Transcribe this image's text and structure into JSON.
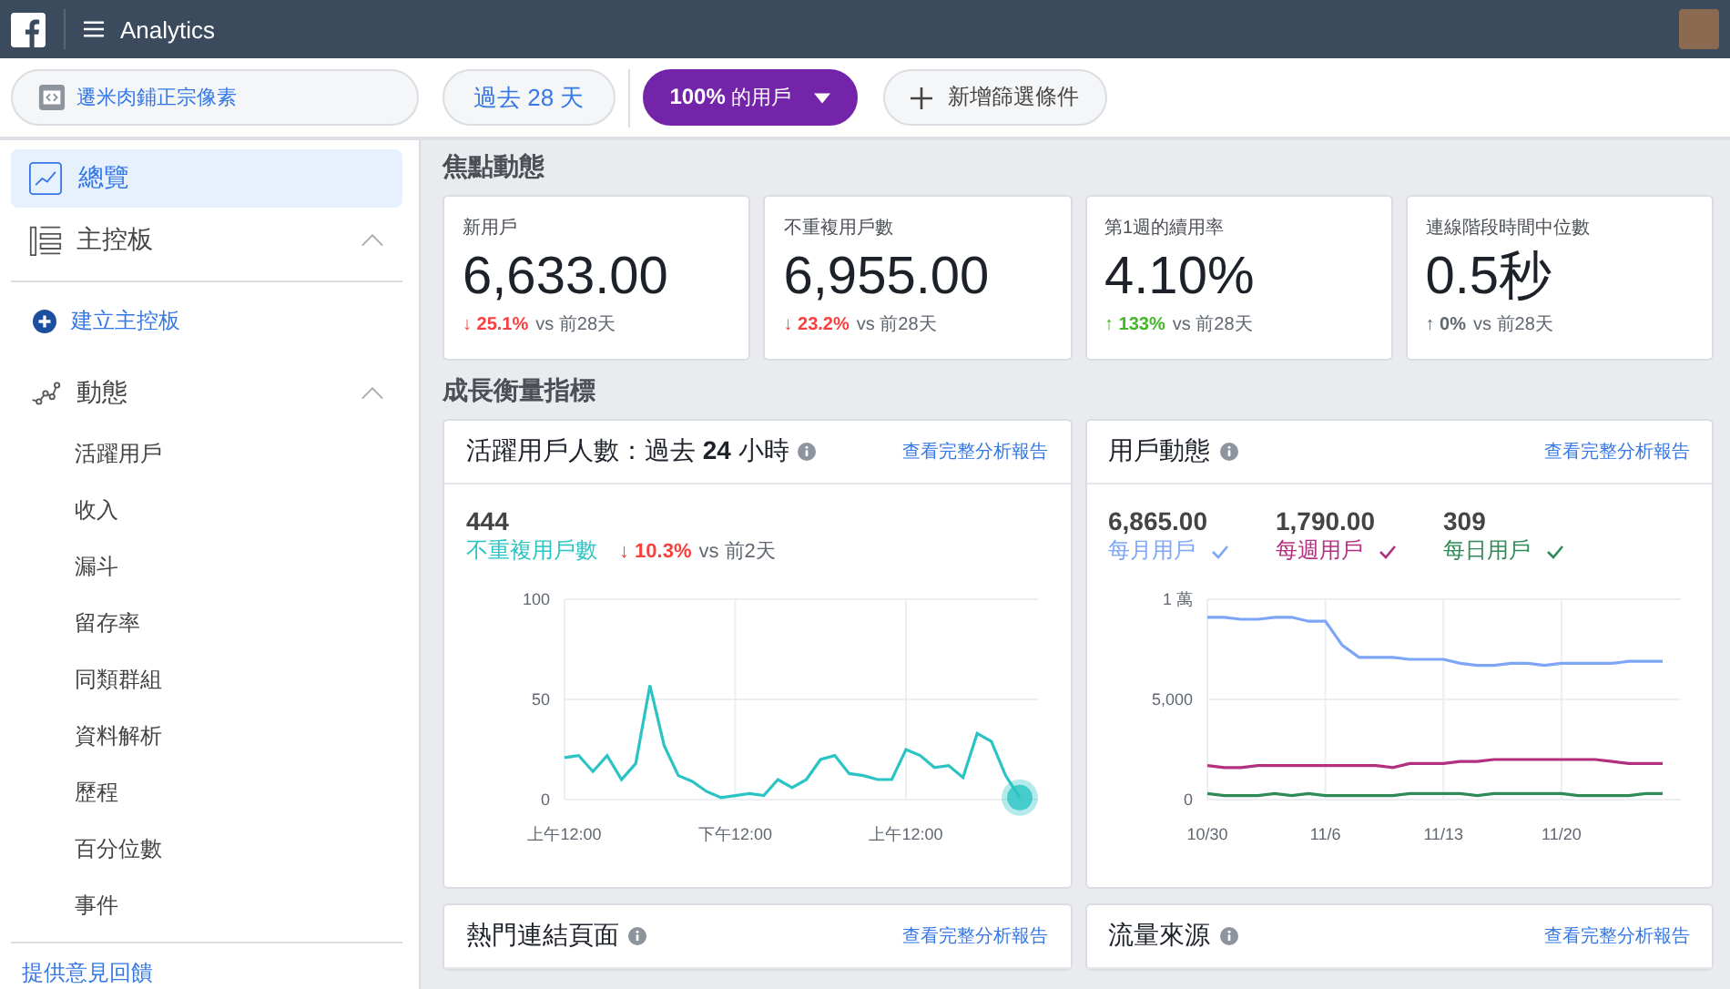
{
  "top_bar": {
    "title": "Analytics"
  },
  "filters": {
    "source": "遷米肉鋪正宗像素",
    "date_range": "過去 28 天",
    "segment": "**100%** 的用戶",
    "add_filter": "新增篩選條件"
  },
  "sidebar": {
    "items": [
      {
        "kind": "link",
        "label": "總覽",
        "selected": true
      },
      {
        "kind": "section",
        "label": "主控板",
        "expanded": true,
        "children": [
          {
            "kind": "create",
            "label": "建立主控板",
            "selected": false
          }
        ]
      },
      {
        "kind": "section",
        "label": "動態",
        "expanded": true,
        "children": [
          {
            "kind": "link",
            "label": "活躍用戶",
            "selected": false
          },
          {
            "kind": "link",
            "label": "收入",
            "selected": false
          },
          {
            "kind": "link",
            "label": "漏斗",
            "selected": false
          },
          {
            "kind": "link",
            "label": "留存率",
            "selected": false
          },
          {
            "kind": "link",
            "label": "同類群組",
            "selected": false
          },
          {
            "kind": "link",
            "label": "資料解析",
            "selected": false
          },
          {
            "kind": "link",
            "label": "歷程",
            "selected": false
          },
          {
            "kind": "link",
            "label": "百分位數",
            "selected": false
          },
          {
            "kind": "link",
            "label": "事件",
            "selected": false
          }
        ]
      }
    ],
    "feedback": "提供意見回饋"
  },
  "highlights": {
    "title": "焦點動態",
    "metrics": [
      {
        "label": "新用戶",
        "value": "6,633.00",
        "arrow": "↓",
        "change": "25.1%",
        "color": "#fa3e3e",
        "comparison": "vs 前28天"
      },
      {
        "label": "不重複用戶數",
        "value": "6,955.00",
        "arrow": "↓",
        "change": "23.2%",
        "color": "#fa3e3e",
        "comparison": "vs 前28天"
      },
      {
        "label": "第1週的續用率",
        "value": "4.10%",
        "arrow": "↑",
        "change": "133%",
        "color": "#42b72a",
        "comparison": "vs 前28天"
      },
      {
        "label": "連線階段時間中位數",
        "value": "0.5秒",
        "arrow": "↑",
        "change": "0%",
        "color": "#606770",
        "comparison": "vs 前28天"
      }
    ]
  },
  "growth": {
    "title": "成長衡量指標",
    "cards": [
      {
        "kind": "single",
        "title": "活躍用戶人數：過去 **24** 小時",
        "link": "查看完整分析報告",
        "total": "444",
        "arrow": "↓",
        "change": "10.3%",
        "color": "#fa3e3e",
        "comparison": "vs 前2天",
        "chart_data": {
          "type": "line",
          "categories": [
            "上午12:00",
            null,
            null,
            null,
            null,
            null,
            null,
            null,
            null,
            null,
            null,
            null,
            "下午12:00",
            null,
            null,
            null,
            null,
            null,
            null,
            null,
            null,
            null,
            null,
            null,
            "上午12:00",
            null,
            null,
            null,
            null,
            null,
            null,
            null,
            null
          ],
          "series": [
            {
              "name": "不重複用戶數",
              "color": "#2bc4c4",
              "values": [
                21,
                22,
                14,
                22,
                10,
                18,
                57,
                27,
                12,
                9,
                4,
                1,
                2,
                3,
                2,
                10,
                6,
                10,
                20,
                22,
                13,
                12,
                10,
                10,
                25,
                22,
                16,
                17,
                11,
                33,
                29,
                12,
                1
              ]
            }
          ],
          "ylim": [
            0,
            100
          ],
          "yticks": [
            0,
            50,
            100
          ],
          "grid": true
        }
      },
      {
        "kind": "multi",
        "title": "用戶動態",
        "link": "查看完整分析報告",
        "totals": [
          "6,865.00",
          "1,790.00",
          "309"
        ],
        "chart_data": {
          "type": "line",
          "categories": [
            "10/30",
            null,
            null,
            null,
            null,
            null,
            null,
            "11/6",
            null,
            null,
            null,
            null,
            null,
            null,
            "11/13",
            null,
            null,
            null,
            null,
            null,
            null,
            "11/20",
            null,
            null,
            null,
            null,
            null,
            null
          ],
          "series": [
            {
              "name": "每月用戶",
              "color": "#7ea6f8",
              "values": [
                9100,
                9100,
                9000,
                9000,
                9100,
                9100,
                8900,
                8900,
                7700,
                7100,
                7100,
                7100,
                7000,
                7000,
                7000,
                6800,
                6700,
                6700,
                6800,
                6800,
                6700,
                6800,
                6800,
                6800,
                6800,
                6900,
                6900,
                6900
              ]
            },
            {
              "name": "每週用戶",
              "color": "#b3307e",
              "values": [
                1700,
                1600,
                1600,
                1700,
                1700,
                1700,
                1700,
                1700,
                1700,
                1700,
                1700,
                1600,
                1800,
                1800,
                1800,
                1900,
                1900,
                2000,
                2000,
                2000,
                2000,
                2000,
                2000,
                2000,
                1900,
                1800,
                1800,
                1800
              ]
            },
            {
              "name": "每日用戶",
              "color": "#2e8b57",
              "values": [
                300,
                200,
                200,
                200,
                300,
                200,
                300,
                200,
                200,
                200,
                200,
                200,
                300,
                300,
                300,
                300,
                200,
                300,
                300,
                300,
                300,
                300,
                200,
                200,
                200,
                200,
                300,
                300
              ]
            }
          ],
          "ylim": [
            0,
            10000
          ],
          "yticks": [
            0,
            {
              "value": 5000,
              "label": "5,000"
            }
          ],
          "grid": true
        },
        "axis_top_label": "1 萬"
      },
      {
        "kind": "empty",
        "title": "熱門連結頁面",
        "link": "查看完整分析報告"
      },
      {
        "kind": "empty",
        "title": "流量來源",
        "link": "查看完整分析報告"
      }
    ]
  }
}
